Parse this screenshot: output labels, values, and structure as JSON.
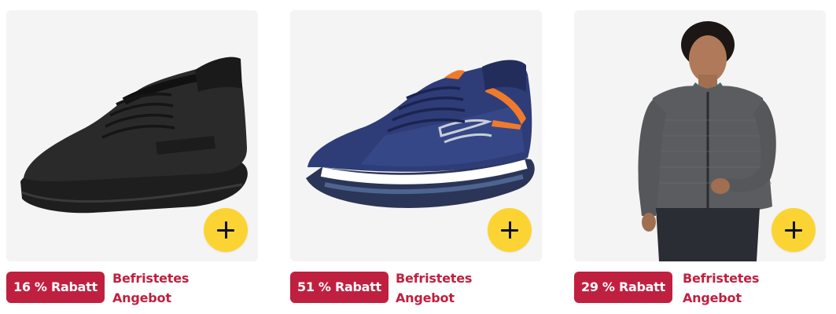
{
  "products": [
    {
      "image": "black-knit-sneaker",
      "discount": "16 % Rabatt",
      "deal_label": "Befristetes Angebot",
      "add_label": "+"
    },
    {
      "image": "navy-orange-air-sneaker",
      "discount": "51 % Rabatt",
      "deal_label": "Befristetes Angebot",
      "add_label": "+"
    },
    {
      "image": "gray-zip-jacket-model",
      "discount": "29 % Rabatt",
      "deal_label": "Befristetes Angebot",
      "add_label": "+"
    }
  ],
  "colors": {
    "badge_bg": "#c0203f",
    "add_button_bg": "#fbd433",
    "image_bg": "#f4f4f4"
  }
}
